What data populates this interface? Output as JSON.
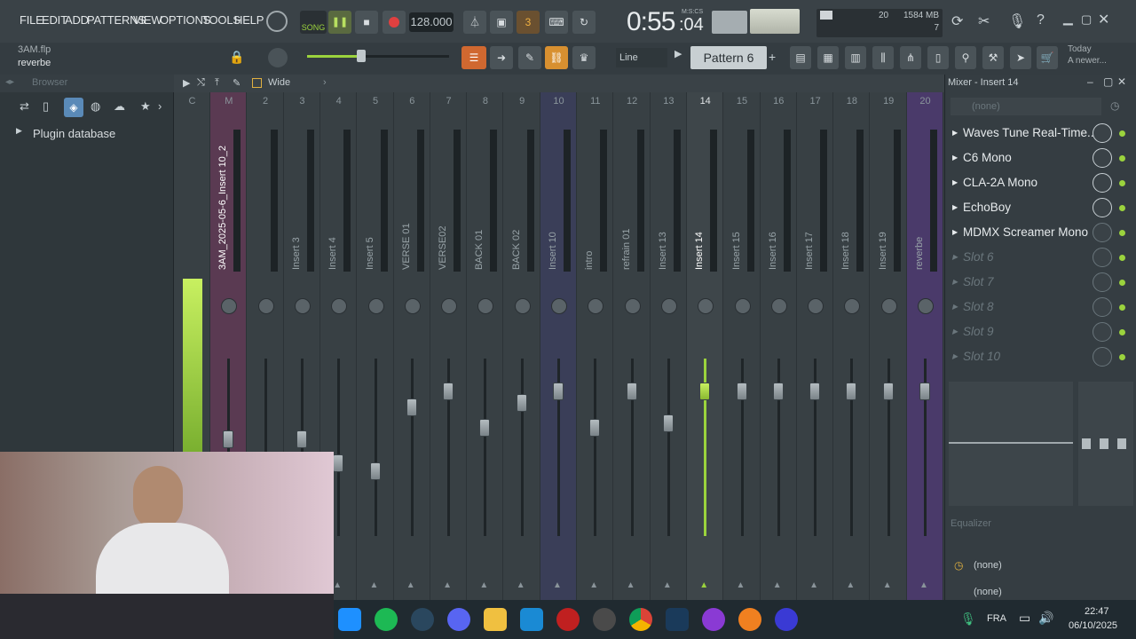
{
  "menu": [
    "FILE",
    "EDIT",
    "ADD",
    "PATTERNS",
    "VIEW",
    "OPTIONS",
    "TOOLS",
    "HELP"
  ],
  "transport": {
    "mode": "SONG",
    "tempo": "128.000",
    "time": "0:55",
    "time_sub": ":04",
    "time_label": "M:S:CS",
    "cpu": "20",
    "mem": "1584 MB",
    "mem_sub": "7"
  },
  "hint": {
    "project": "3AM.flp",
    "selected": "reverbe"
  },
  "toolbar": {
    "snap": "Line",
    "pattern": "Pattern 6",
    "news_line1": "Today",
    "news_line2": "A newer..."
  },
  "browser": {
    "title": "Browser",
    "item": "Plugin database"
  },
  "mixer_view": {
    "mode": "Wide"
  },
  "strips": [
    {
      "num": "C",
      "name": "",
      "fader": 0.0
    },
    {
      "num": "M",
      "name": "3AM_2025-05-6_Insert 10_2",
      "fader": 0.55
    },
    {
      "num": "2",
      "name": "",
      "fader": 0.4
    },
    {
      "num": "3",
      "name": "Insert 3",
      "fader": 0.55
    },
    {
      "num": "4",
      "name": "Insert 4",
      "fader": 0.4
    },
    {
      "num": "5",
      "name": "Insert 5",
      "fader": 0.35
    },
    {
      "num": "6",
      "name": "VERSE 01",
      "fader": 0.75
    },
    {
      "num": "7",
      "name": "VERSE02",
      "fader": 0.85
    },
    {
      "num": "8",
      "name": "BACK 01",
      "fader": 0.62
    },
    {
      "num": "9",
      "name": "BACK 02",
      "fader": 0.78
    },
    {
      "num": "10",
      "name": "Insert 10",
      "fader": 0.85
    },
    {
      "num": "11",
      "name": "intro",
      "fader": 0.62
    },
    {
      "num": "12",
      "name": "refrain 01",
      "fader": 0.85
    },
    {
      "num": "13",
      "name": "Insert 13",
      "fader": 0.65
    },
    {
      "num": "14",
      "name": "Insert 14",
      "fader": 0.85
    },
    {
      "num": "15",
      "name": "Insert 15",
      "fader": 0.85
    },
    {
      "num": "16",
      "name": "Insert 16",
      "fader": 0.85
    },
    {
      "num": "17",
      "name": "Insert 17",
      "fader": 0.85
    },
    {
      "num": "18",
      "name": "Insert 18",
      "fader": 0.85
    },
    {
      "num": "19",
      "name": "Insert 19",
      "fader": 0.85
    },
    {
      "num": "20",
      "name": "reverbe",
      "fader": 0.85
    }
  ],
  "rack": {
    "title": "Mixer - Insert 14",
    "input": "(none)",
    "slots": [
      "Waves Tune Real-Time...",
      "C6 Mono",
      "CLA-2A Mono",
      "EchoBoy",
      "MDMX Screamer Mono",
      "Slot 6",
      "Slot 7",
      "Slot 8",
      "Slot 9",
      "Slot 10"
    ],
    "eq_label": "Equalizer",
    "out1": "(none)",
    "out2": "(none)"
  },
  "taskbar": {
    "lang": "FRA",
    "time": "22:47",
    "date": "06/10/2025"
  },
  "colors": {
    "accent_green": "#9bd33d",
    "selected": "#5a6a40",
    "master": "#7a3a5a",
    "purple": "#4a3a7a",
    "record": "#e04040"
  }
}
